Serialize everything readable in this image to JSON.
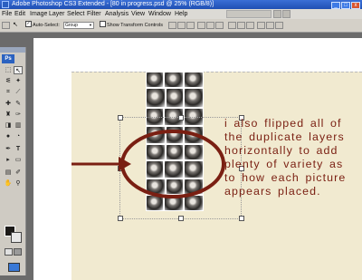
{
  "window": {
    "title": "Adobe Photoshop CS3 Extended - [80 in progress.psd @ 25% (RGB/8)]",
    "min_symbol": "_",
    "max_symbol": "□",
    "close_symbol": "x"
  },
  "menu": {
    "items": [
      "File",
      "Edit",
      "Image",
      "Layer",
      "Select",
      "Filter",
      "Analysis",
      "View",
      "Window",
      "Help"
    ]
  },
  "options": {
    "auto_select_label": "Auto-Select:",
    "auto_select_value": "Group",
    "show_transform_label": "Show Transform Controls",
    "auto_select_checked": true,
    "show_transform_checked": false
  },
  "toolbox": {
    "logo": "Ps",
    "tools": [
      "move-tool-icon",
      "marquee-tool-icon",
      "lasso-tool-icon",
      "magic-wand-tool-icon",
      "crop-tool-icon",
      "slice-tool-icon",
      "healing-brush-tool-icon",
      "brush-tool-icon",
      "clone-stamp-tool-icon",
      "history-brush-tool-icon",
      "eraser-tool-icon",
      "gradient-tool-icon",
      "blur-tool-icon",
      "dodge-tool-icon",
      "pen-tool-icon",
      "type-tool-icon",
      "path-selection-tool-icon",
      "shape-tool-icon",
      "notes-tool-icon",
      "eyedropper-tool-icon",
      "hand-tool-icon",
      "zoom-tool-icon"
    ],
    "foreground_color": "#1c1a18",
    "background_color": "#e8e8e8"
  },
  "canvas": {
    "caption": "i also flipped all of the duplicate layers horizontally to add plenty of variety as to how each picture appears placed.",
    "accent_color": "#7a1f12",
    "paper_color": "#f1ead0"
  }
}
